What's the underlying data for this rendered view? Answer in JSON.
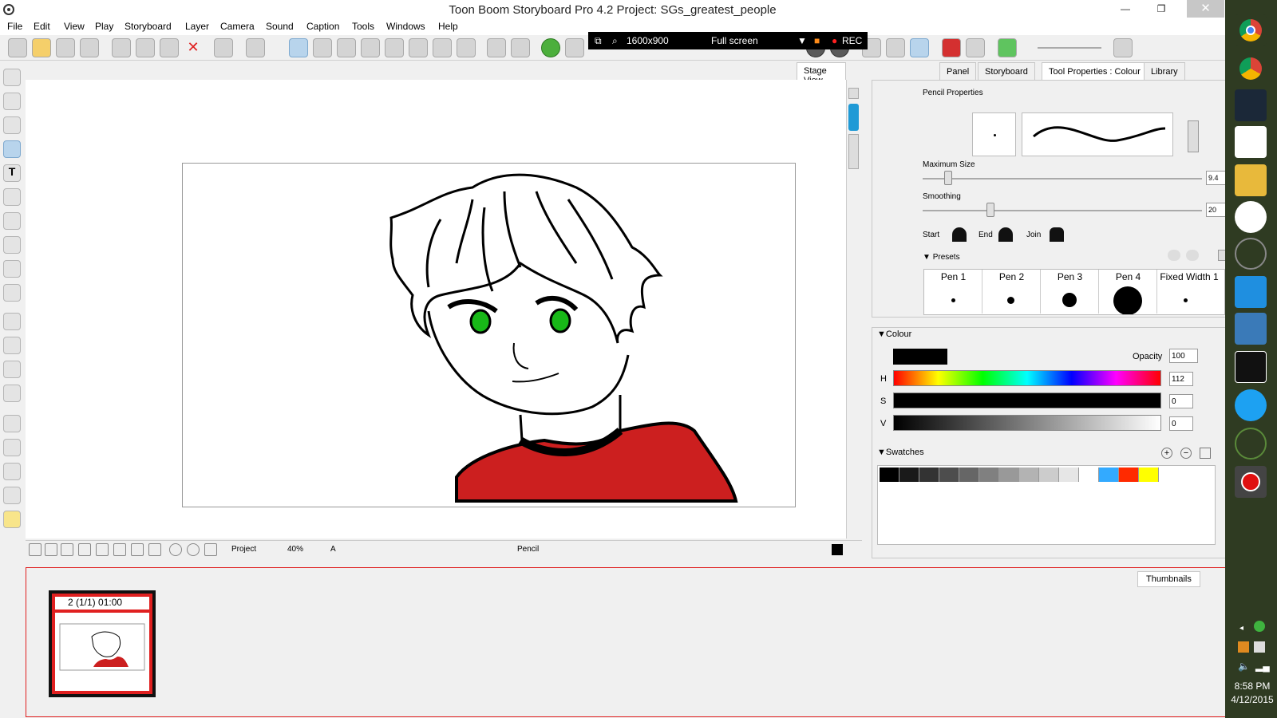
{
  "window": {
    "title": "Toon Boom Storyboard Pro 4.2 Project: SGs_greatest_people",
    "minimize_glyph": "—",
    "maximize_glyph": "❐",
    "close_glyph": "✕"
  },
  "menu": [
    "File",
    "Edit",
    "View",
    "Play",
    "Storyboard",
    "Layer",
    "Camera",
    "Sound",
    "Caption",
    "Tools",
    "Windows",
    "Help"
  ],
  "recorder": {
    "resolution": "1600x900",
    "mode": "Full screen",
    "rec_label": "REC"
  },
  "stage": {
    "tab_label": "Stage View",
    "status": {
      "view_mode": "Project",
      "zoom": "40%",
      "layer": "A",
      "tool": "Pencil"
    }
  },
  "right_panel": {
    "tabs": [
      "Panel",
      "Storyboard",
      "Tool Properties : Colour",
      "Library"
    ],
    "active_tab": "Tool Properties : Colour",
    "pencil": {
      "title": "Pencil Properties",
      "max_size_label": "Maximum Size",
      "max_size_value": "9.4",
      "smoothing_label": "Smoothing",
      "smoothing_value": "20",
      "start_label": "Start",
      "end_label": "End",
      "join_label": "Join",
      "presets_label": "Presets",
      "presets": [
        "Pen 1",
        "Pen 2",
        "Pen 3",
        "Pen 4",
        "Fixed Width 1"
      ]
    },
    "colour": {
      "title": "Colour",
      "current_colour": "#000000",
      "opacity_label": "Opacity",
      "opacity_value": "100",
      "h_label": "H",
      "h_value": "112",
      "s_label": "S",
      "s_value": "0",
      "v_label": "V",
      "v_value": "0"
    },
    "swatches": {
      "title": "Swatches",
      "colors": [
        "#000000",
        "#1a1a1a",
        "#333333",
        "#4d4d4d",
        "#666666",
        "#808080",
        "#999999",
        "#b3b3b3",
        "#cccccc",
        "#e6e6e6",
        "#ffffff",
        "#33aaff",
        "#ff2a00",
        "#ffff00"
      ]
    }
  },
  "thumbnails": {
    "tab_label": "Thumbnails",
    "panel_label": "2 (1/1) 01:00"
  },
  "taskbar": {
    "time": "8:58 PM",
    "date": "4/12/2015"
  }
}
